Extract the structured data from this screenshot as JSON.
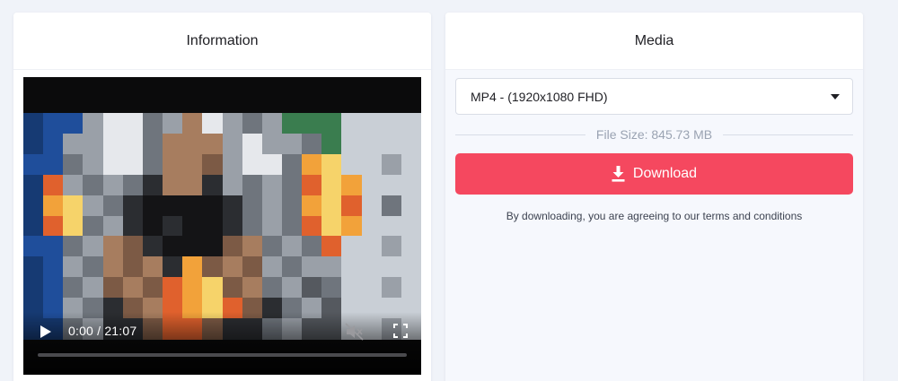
{
  "info_card": {
    "title": "Information"
  },
  "player": {
    "current_time": "0:00",
    "separator": "/",
    "duration": "21:07",
    "time_display": "0:00 / 21:07",
    "progress": 0,
    "muted": true,
    "icons": {
      "play": "play-icon",
      "mute": "volume-muted-icon",
      "fullscreen": "fullscreen-icon"
    }
  },
  "media_card": {
    "title": "Media",
    "format_select": {
      "selected": "MP4 - (1920x1080 FHD)"
    },
    "file_size": "File Size: 845.73 MB",
    "download_label": "Download",
    "download_icon": "download-icon",
    "terms_text": "By downloading, you are agreeing to our terms and conditions"
  },
  "colors": {
    "page_background": "#f0f3f9",
    "download_button": "#f5485f",
    "media_panel": "#f6f8fd",
    "muted_text": "#9aa3b2"
  }
}
